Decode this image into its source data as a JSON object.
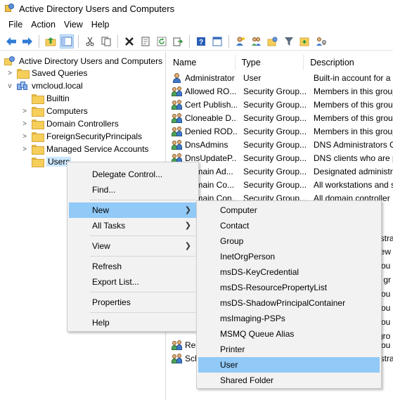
{
  "window": {
    "title": "Active Directory Users and Computers"
  },
  "menubar": [
    "File",
    "Action",
    "View",
    "Help"
  ],
  "toolbar": [
    "back",
    "forward",
    "up",
    "show-tree",
    "cut",
    "copy",
    "delete",
    "properties",
    "refresh",
    "export",
    "help",
    "user-console",
    "new-user",
    "new-group",
    "filter",
    "add-to-group",
    "delegate"
  ],
  "tree": {
    "root": "Active Directory Users and Computers",
    "items": [
      {
        "label": "Saved Queries",
        "level": 1,
        "expander": ">"
      },
      {
        "label": "vmcloud.local",
        "level": 1,
        "expander": "v"
      },
      {
        "label": "Builtin",
        "level": 2,
        "expander": ""
      },
      {
        "label": "Computers",
        "level": 2,
        "expander": ">"
      },
      {
        "label": "Domain Controllers",
        "level": 2,
        "expander": ">"
      },
      {
        "label": "ForeignSecurityPrincipals",
        "level": 2,
        "expander": ">"
      },
      {
        "label": "Managed Service Accounts",
        "level": 2,
        "expander": ">"
      },
      {
        "label": "Users",
        "level": 2,
        "expander": "",
        "selected": true
      }
    ]
  },
  "list": {
    "columns": [
      "Name",
      "Type",
      "Description"
    ],
    "rows": [
      {
        "name": "Administrator",
        "type": "User",
        "desc": "Built-in account for a",
        "icon": "user"
      },
      {
        "name": "Allowed RO...",
        "type": "Security Group...",
        "desc": "Members in this group",
        "icon": "group"
      },
      {
        "name": "Cert Publish...",
        "type": "Security Group...",
        "desc": "Members of this group",
        "icon": "group"
      },
      {
        "name": "Cloneable D...",
        "type": "Security Group...",
        "desc": "Members of this group",
        "icon": "group"
      },
      {
        "name": "Denied ROD...",
        "type": "Security Group...",
        "desc": "Members in this group",
        "icon": "group"
      },
      {
        "name": "DnsAdmins",
        "type": "Security Group...",
        "desc": "DNS Administrators G",
        "icon": "group"
      },
      {
        "name": "DnsUpdateP...",
        "type": "Security Group...",
        "desc": "DNS clients who are p",
        "icon": "group"
      },
      {
        "name": "Domain Ad...",
        "type": "Security Group...",
        "desc": "Designated administr",
        "icon": "group"
      },
      {
        "name": "Domain Co...",
        "type": "Security Group...",
        "desc": "All workstations and s",
        "icon": "group"
      },
      {
        "name": "Domain Con...",
        "type": "Security Group...",
        "desc": "All domain controller",
        "icon": "group"
      }
    ],
    "partial_rows": [
      {
        "name": "",
        "desc": "istra"
      },
      {
        "name": "",
        "desc": "iew"
      },
      {
        "name": "",
        "desc": "rou"
      },
      {
        "name": "",
        "desc": "r gr"
      },
      {
        "name": "",
        "desc": "rou"
      },
      {
        "name": "",
        "desc": "rou"
      },
      {
        "name": "",
        "desc": "rou"
      },
      {
        "name": "",
        "desc": "gro"
      },
      {
        "name": "",
        "desc": ""
      },
      {
        "name": "Rea",
        "desc": "rou"
      },
      {
        "name": "Sch",
        "desc": "istra"
      }
    ]
  },
  "context_menu": {
    "items": [
      {
        "label": "Delegate Control...",
        "arrow": false
      },
      {
        "label": "Find...",
        "arrow": false
      },
      {
        "label": "New",
        "arrow": true,
        "highlighted": true
      },
      {
        "label": "All Tasks",
        "arrow": true
      },
      {
        "label": "View",
        "arrow": true
      },
      {
        "label": "Refresh",
        "arrow": false
      },
      {
        "label": "Export List...",
        "arrow": false
      },
      {
        "label": "Properties",
        "arrow": false
      },
      {
        "label": "Help",
        "arrow": false
      }
    ]
  },
  "submenu": {
    "items": [
      "Computer",
      "Contact",
      "Group",
      "InetOrgPerson",
      "msDS-KeyCredential",
      "msDS-ResourcePropertyList",
      "msDS-ShadowPrincipalContainer",
      "msImaging-PSPs",
      "MSMQ Queue Alias",
      "Printer",
      "User",
      "Shared Folder"
    ],
    "highlighted": "User"
  },
  "colors": {
    "menu_highlight": "#91c9f7",
    "tree_selected": "#cce8ff",
    "accent": "#1a73d9"
  }
}
